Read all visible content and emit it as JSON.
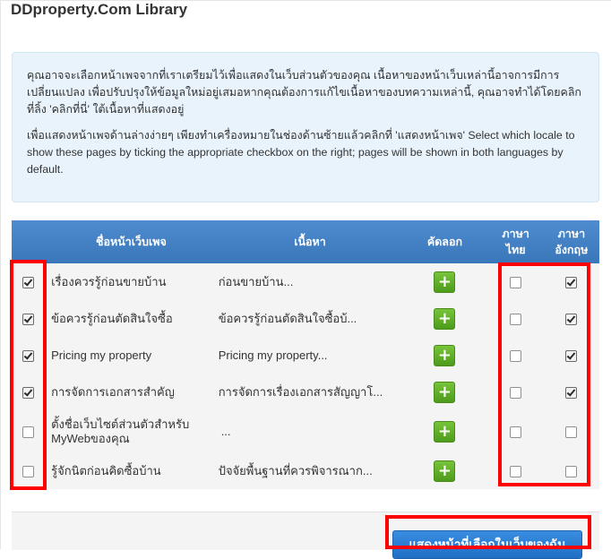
{
  "page": {
    "title": "DDproperty.Com Library"
  },
  "info": {
    "paragraph1": "คุณอาจจะเลือกหน้าเพจจากที่เราเตรียมไว้เพื่อแสดงในเว็บส่วนตัวของคุณ เนื้อหาของหน้าเว็บเหล่านี้อาจการมีการเปลี่ยนแปลง เพื่อปรับปรุงให้ข้อมูลใหม่อยู่เสมอหากคุณต้องการแก้ไขเนื้อหาของบทความเหล่านี้, คุณอาจทำได้โดยคลิกที่ลิ้ง 'คลิกที่นี่' ใต้เนื้อหาที่แสดงอยู่",
    "paragraph2": "เพื่อแสดงหน้าเพจด้านล่างง่ายๆ เพียงทำเครื่องหมายในช่องด้านซ้ายแล้วคลิกที่ 'แสดงหน้าเพจ' Select which locale to show these pages by ticking the appropriate checkbox on the right; pages will be shown in both languages by default."
  },
  "table": {
    "headers": {
      "name": "ชื่อหน้าเว็บเพจ",
      "content": "เนื้อหา",
      "copy": "คัดลอก",
      "thai_line1": "ภาษา",
      "thai_line2": "ไทย",
      "english_line1": "ภาษา",
      "english_line2": "อังกฤษ"
    },
    "rows": [
      {
        "selected": true,
        "name": "เรื่องควรรู้ก่อนขายบ้าน",
        "content": "ก่อนขายบ้าน...",
        "thai": false,
        "english": true
      },
      {
        "selected": true,
        "name": "ข้อควรรู้ก่อนตัดสินใจซื้อ",
        "content": "ข้อควรรู้ก่อนตัดสินใจซื้อบ้...",
        "thai": false,
        "english": true
      },
      {
        "selected": true,
        "name": "Pricing my property",
        "content": "Pricing my property...",
        "thai": false,
        "english": true
      },
      {
        "selected": true,
        "name": "การจัดการเอกสารสำคัญ",
        "content": "การจัดการเรื่องเอกสารสัญญาโ...",
        "thai": false,
        "english": true
      },
      {
        "selected": false,
        "name_line1": "ตั้งชื่อเว็บไซต์ส่วนตัวสำหรับ",
        "name_line2": "MyWebของคุณ",
        "content": "...",
        "thai": false,
        "english": false
      },
      {
        "selected": false,
        "name": "รู้จักนิตก่อนคิดซื้อบ้าน",
        "content": "ปัจจัยพื้นฐานที่ควรพิจารณาก...",
        "thai": false,
        "english": false
      }
    ],
    "copy_icon": "plus-icon"
  },
  "actions": {
    "show_button": "แสดงหน้าที่เลือกในเว็บของฉัน"
  },
  "colors": {
    "header_blue": "#4a86c8",
    "info_bg": "#e8f3fb",
    "copy_green": "#5fae29",
    "highlight_red": "#ff0000",
    "button_blue": "#2a7dd6"
  }
}
